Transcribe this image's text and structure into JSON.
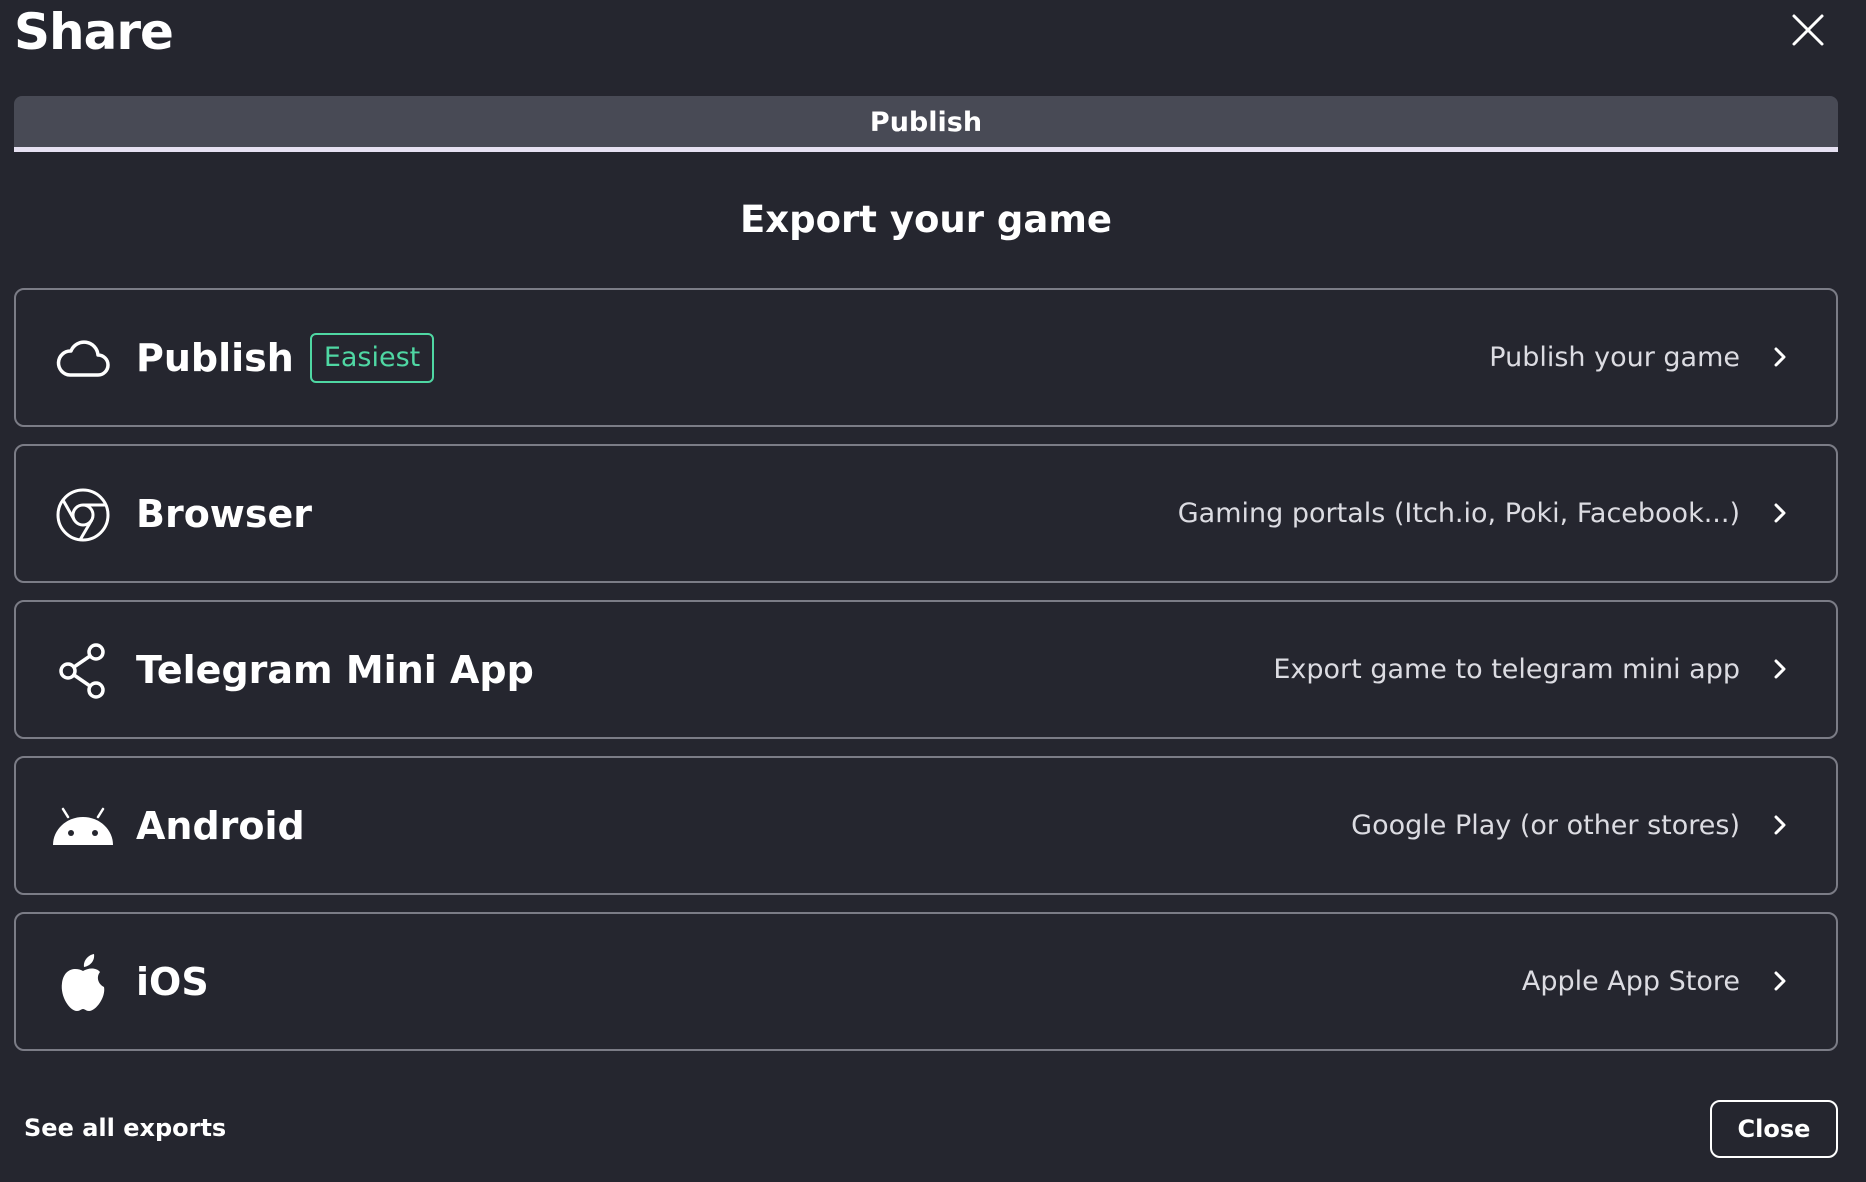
{
  "dialog": {
    "title": "Share",
    "close_icon": "close-icon"
  },
  "tabs": [
    {
      "label": "Publish",
      "active": true
    }
  ],
  "heading": "Export your game",
  "options": [
    {
      "label": "Publish",
      "badge": "Easiest",
      "description": "Publish your game",
      "icon": "cloud-icon"
    },
    {
      "label": "Browser",
      "description": "Gaming portals (Itch.io, Poki, Facebook...)",
      "icon": "chrome-icon"
    },
    {
      "label": "Telegram Mini App",
      "description": "Export game to telegram mini app",
      "icon": "share-icon"
    },
    {
      "label": "Android",
      "description": "Google Play (or other stores)",
      "icon": "android-icon"
    },
    {
      "label": "iOS",
      "description": "Apple App Store",
      "icon": "apple-icon"
    }
  ],
  "footer": {
    "see_all": "See all exports",
    "close_label": "Close"
  },
  "colors": {
    "background": "#25262f",
    "tab_background": "#484a55",
    "border": "#7b7c86",
    "badge": "#4fd7a3"
  }
}
